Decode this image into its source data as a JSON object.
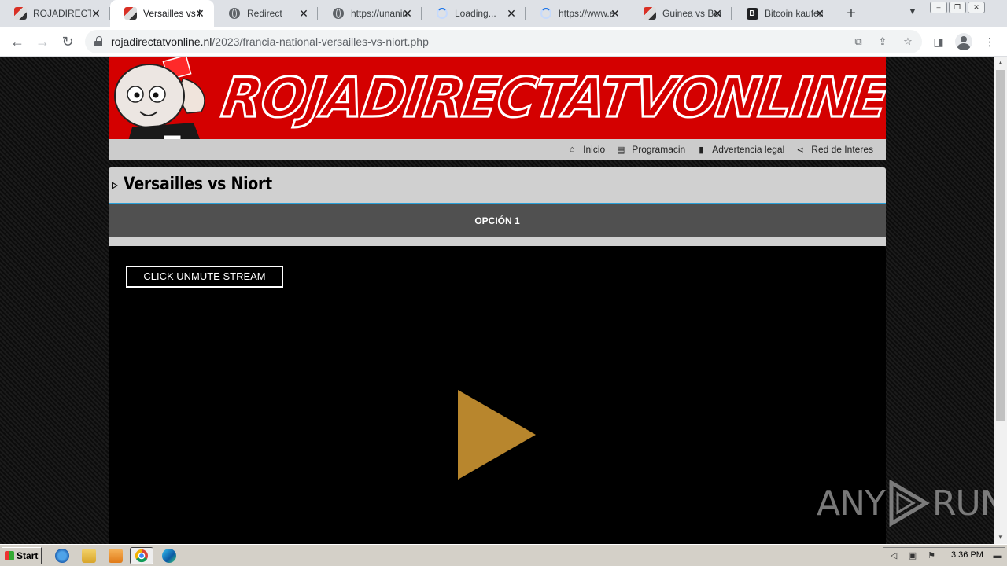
{
  "browser": {
    "tabs": [
      {
        "title": "ROJADIRECTA",
        "favicon": "face",
        "active": false
      },
      {
        "title": "Versailles vs N",
        "favicon": "face",
        "active": true
      },
      {
        "title": "Redirect",
        "favicon": "globe",
        "active": false
      },
      {
        "title": "https://unanin",
        "favicon": "globe",
        "active": false
      },
      {
        "title": "Loading...",
        "favicon": "spinner",
        "active": false
      },
      {
        "title": "https://www.a",
        "favicon": "spinner",
        "active": false
      },
      {
        "title": "Guinea vs Ben",
        "favicon": "face",
        "active": false
      },
      {
        "title": "Bitcoin kaufen",
        "favicon": "bitcoin",
        "active": false
      }
    ],
    "address": {
      "domain": "rojadirectatvonline.nl",
      "path": "/2023/francia-national-versailles-vs-niort.php"
    }
  },
  "site": {
    "logo_text": "ROJADIRECTATVONLINE",
    "nav": [
      {
        "label": "Inicio",
        "icon": "home-icon"
      },
      {
        "label": "Programacin",
        "icon": "list-icon"
      },
      {
        "label": "Advertencia legal",
        "icon": "book-icon"
      },
      {
        "label": "Red de Interes",
        "icon": "share-icon"
      }
    ],
    "page_title": "Versailles vs Niort",
    "option_label": "OPCIÓN 1",
    "player": {
      "unmute_label": "CLICK UNMUTE STREAM"
    },
    "colors": {
      "banner_red": "#d40000",
      "play_gold": "#b8862d",
      "option_bar": "#505050",
      "accent_blue": "#2aa0d8"
    }
  },
  "watermark": {
    "left": "ANY",
    "right": "RUN"
  },
  "taskbar": {
    "start_label": "Start",
    "clock": "3:36 PM"
  }
}
